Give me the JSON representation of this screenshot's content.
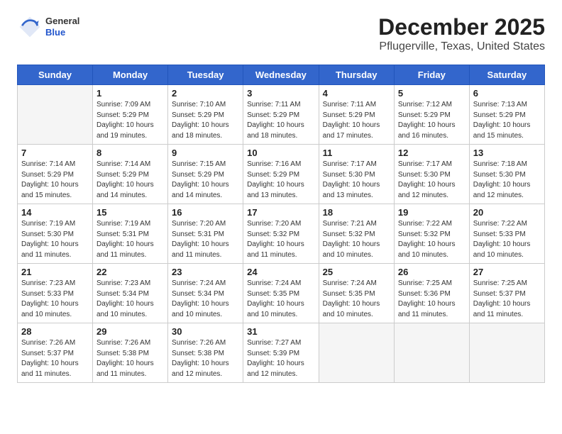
{
  "header": {
    "logo_general": "General",
    "logo_blue": "Blue",
    "month": "December 2025",
    "location": "Pflugerville, Texas, United States"
  },
  "days_of_week": [
    "Sunday",
    "Monday",
    "Tuesday",
    "Wednesday",
    "Thursday",
    "Friday",
    "Saturday"
  ],
  "weeks": [
    [
      {
        "day": "",
        "sunrise": "",
        "sunset": "",
        "daylight": "",
        "empty": true
      },
      {
        "day": "1",
        "sunrise": "Sunrise: 7:09 AM",
        "sunset": "Sunset: 5:29 PM",
        "daylight": "Daylight: 10 hours and 19 minutes."
      },
      {
        "day": "2",
        "sunrise": "Sunrise: 7:10 AM",
        "sunset": "Sunset: 5:29 PM",
        "daylight": "Daylight: 10 hours and 18 minutes."
      },
      {
        "day": "3",
        "sunrise": "Sunrise: 7:11 AM",
        "sunset": "Sunset: 5:29 PM",
        "daylight": "Daylight: 10 hours and 18 minutes."
      },
      {
        "day": "4",
        "sunrise": "Sunrise: 7:11 AM",
        "sunset": "Sunset: 5:29 PM",
        "daylight": "Daylight: 10 hours and 17 minutes."
      },
      {
        "day": "5",
        "sunrise": "Sunrise: 7:12 AM",
        "sunset": "Sunset: 5:29 PM",
        "daylight": "Daylight: 10 hours and 16 minutes."
      },
      {
        "day": "6",
        "sunrise": "Sunrise: 7:13 AM",
        "sunset": "Sunset: 5:29 PM",
        "daylight": "Daylight: 10 hours and 15 minutes."
      }
    ],
    [
      {
        "day": "7",
        "sunrise": "Sunrise: 7:14 AM",
        "sunset": "Sunset: 5:29 PM",
        "daylight": "Daylight: 10 hours and 15 minutes."
      },
      {
        "day": "8",
        "sunrise": "Sunrise: 7:14 AM",
        "sunset": "Sunset: 5:29 PM",
        "daylight": "Daylight: 10 hours and 14 minutes."
      },
      {
        "day": "9",
        "sunrise": "Sunrise: 7:15 AM",
        "sunset": "Sunset: 5:29 PM",
        "daylight": "Daylight: 10 hours and 14 minutes."
      },
      {
        "day": "10",
        "sunrise": "Sunrise: 7:16 AM",
        "sunset": "Sunset: 5:29 PM",
        "daylight": "Daylight: 10 hours and 13 minutes."
      },
      {
        "day": "11",
        "sunrise": "Sunrise: 7:17 AM",
        "sunset": "Sunset: 5:30 PM",
        "daylight": "Daylight: 10 hours and 13 minutes."
      },
      {
        "day": "12",
        "sunrise": "Sunrise: 7:17 AM",
        "sunset": "Sunset: 5:30 PM",
        "daylight": "Daylight: 10 hours and 12 minutes."
      },
      {
        "day": "13",
        "sunrise": "Sunrise: 7:18 AM",
        "sunset": "Sunset: 5:30 PM",
        "daylight": "Daylight: 10 hours and 12 minutes."
      }
    ],
    [
      {
        "day": "14",
        "sunrise": "Sunrise: 7:19 AM",
        "sunset": "Sunset: 5:30 PM",
        "daylight": "Daylight: 10 hours and 11 minutes."
      },
      {
        "day": "15",
        "sunrise": "Sunrise: 7:19 AM",
        "sunset": "Sunset: 5:31 PM",
        "daylight": "Daylight: 10 hours and 11 minutes."
      },
      {
        "day": "16",
        "sunrise": "Sunrise: 7:20 AM",
        "sunset": "Sunset: 5:31 PM",
        "daylight": "Daylight: 10 hours and 11 minutes."
      },
      {
        "day": "17",
        "sunrise": "Sunrise: 7:20 AM",
        "sunset": "Sunset: 5:32 PM",
        "daylight": "Daylight: 10 hours and 11 minutes."
      },
      {
        "day": "18",
        "sunrise": "Sunrise: 7:21 AM",
        "sunset": "Sunset: 5:32 PM",
        "daylight": "Daylight: 10 hours and 10 minutes."
      },
      {
        "day": "19",
        "sunrise": "Sunrise: 7:22 AM",
        "sunset": "Sunset: 5:32 PM",
        "daylight": "Daylight: 10 hours and 10 minutes."
      },
      {
        "day": "20",
        "sunrise": "Sunrise: 7:22 AM",
        "sunset": "Sunset: 5:33 PM",
        "daylight": "Daylight: 10 hours and 10 minutes."
      }
    ],
    [
      {
        "day": "21",
        "sunrise": "Sunrise: 7:23 AM",
        "sunset": "Sunset: 5:33 PM",
        "daylight": "Daylight: 10 hours and 10 minutes."
      },
      {
        "day": "22",
        "sunrise": "Sunrise: 7:23 AM",
        "sunset": "Sunset: 5:34 PM",
        "daylight": "Daylight: 10 hours and 10 minutes."
      },
      {
        "day": "23",
        "sunrise": "Sunrise: 7:24 AM",
        "sunset": "Sunset: 5:34 PM",
        "daylight": "Daylight: 10 hours and 10 minutes."
      },
      {
        "day": "24",
        "sunrise": "Sunrise: 7:24 AM",
        "sunset": "Sunset: 5:35 PM",
        "daylight": "Daylight: 10 hours and 10 minutes."
      },
      {
        "day": "25",
        "sunrise": "Sunrise: 7:24 AM",
        "sunset": "Sunset: 5:35 PM",
        "daylight": "Daylight: 10 hours and 10 minutes."
      },
      {
        "day": "26",
        "sunrise": "Sunrise: 7:25 AM",
        "sunset": "Sunset: 5:36 PM",
        "daylight": "Daylight: 10 hours and 11 minutes."
      },
      {
        "day": "27",
        "sunrise": "Sunrise: 7:25 AM",
        "sunset": "Sunset: 5:37 PM",
        "daylight": "Daylight: 10 hours and 11 minutes."
      }
    ],
    [
      {
        "day": "28",
        "sunrise": "Sunrise: 7:26 AM",
        "sunset": "Sunset: 5:37 PM",
        "daylight": "Daylight: 10 hours and 11 minutes."
      },
      {
        "day": "29",
        "sunrise": "Sunrise: 7:26 AM",
        "sunset": "Sunset: 5:38 PM",
        "daylight": "Daylight: 10 hours and 11 minutes."
      },
      {
        "day": "30",
        "sunrise": "Sunrise: 7:26 AM",
        "sunset": "Sunset: 5:38 PM",
        "daylight": "Daylight: 10 hours and 12 minutes."
      },
      {
        "day": "31",
        "sunrise": "Sunrise: 7:27 AM",
        "sunset": "Sunset: 5:39 PM",
        "daylight": "Daylight: 10 hours and 12 minutes."
      },
      {
        "day": "",
        "sunrise": "",
        "sunset": "",
        "daylight": "",
        "empty": true
      },
      {
        "day": "",
        "sunrise": "",
        "sunset": "",
        "daylight": "",
        "empty": true
      },
      {
        "day": "",
        "sunrise": "",
        "sunset": "",
        "daylight": "",
        "empty": true
      }
    ]
  ]
}
